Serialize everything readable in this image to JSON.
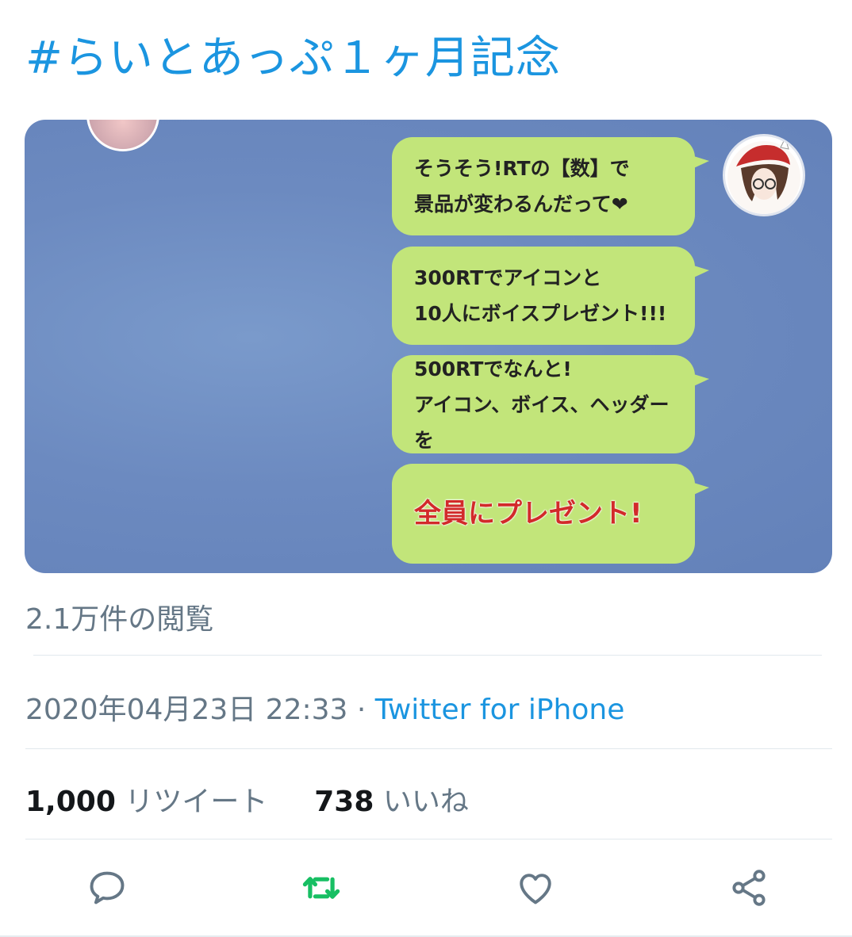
{
  "tweet": {
    "hashtag": "#らいとあっぷ１ヶ月記念",
    "media": {
      "bubbles": [
        {
          "line1": "そうそう!RTの【数】で",
          "line2": "景品が変わるんだって❤"
        },
        {
          "line1": "300RTでアイコンと",
          "line2": "10人にボイスプレゼント!!!"
        },
        {
          "line1": "500RTでなんと!",
          "line2": "アイコン、ボイス、ヘッダーを"
        },
        {
          "line1": "全員にプレゼント!"
        }
      ]
    },
    "views": "2.1万件の閲覧",
    "timestamp": "2020年04月23日 22:33",
    "separator": "·",
    "source": "Twitter for iPhone",
    "stats": {
      "retweets_count": "1,000",
      "retweets_label": "リツイート",
      "likes_count": "738",
      "likes_label": "いいね"
    },
    "actions": [
      {
        "icon": "reply-icon"
      },
      {
        "icon": "retweet-icon",
        "color": "#17bf63"
      },
      {
        "icon": "like-icon"
      },
      {
        "icon": "share-icon"
      }
    ]
  },
  "colors": {
    "link": "#1b95e0",
    "muted": "#657786",
    "retweet_active": "#17bf63",
    "bubble": "#c2e57a",
    "highlight_text": "#d22a2a"
  }
}
